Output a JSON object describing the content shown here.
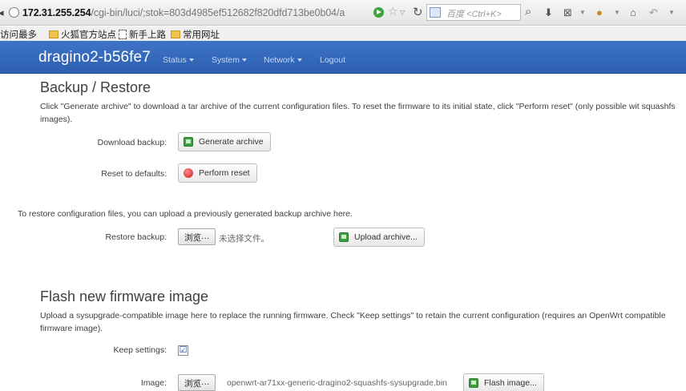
{
  "browser": {
    "url_host": "172.31.255.254",
    "url_path": "/cgi-bin/luci/;stok=803d4985ef512682f820dfd713be0b04/a",
    "search_placeholder": "百度 <Ctrl+K>"
  },
  "bookmarks": [
    "访问最多",
    "火狐官方站点",
    "新手上路",
    "常用网址"
  ],
  "nav": {
    "brand": "dragino2-b56fe7",
    "items": [
      "Status",
      "System",
      "Network",
      "Logout"
    ]
  },
  "backup": {
    "title": "Backup / Restore",
    "description": "Click \"Generate archive\" to download a tar archive of the current configuration files. To reset the firmware to its initial state, click \"Perform reset\" (only possible wit squashfs images).",
    "download_label": "Download backup:",
    "generate_button": "Generate archive",
    "reset_label": "Reset to defaults:",
    "reset_button": "Perform reset",
    "restore_text": "To restore configuration files, you can upload a previously generated backup archive here.",
    "restore_label": "Restore backup:",
    "browse_button": "浏览···",
    "no_file_text": "未选择文件。",
    "upload_button": "Upload archive..."
  },
  "flash": {
    "title": "Flash new firmware image",
    "description": "Upload a sysupgrade-compatible image here to replace the running firmware. Check \"Keep settings\" to retain the current configuration (requires an OpenWrt compatible firmware image).",
    "keep_label": "Keep settings:",
    "keep_checked": true,
    "keep_check_glyph": "☑",
    "image_label": "Image:",
    "browse_button": "浏览···",
    "file_name": "openwrt-ar71xx-generic-dragino2-squashfs-sysupgrade.bin",
    "flash_button": "Flash image..."
  }
}
